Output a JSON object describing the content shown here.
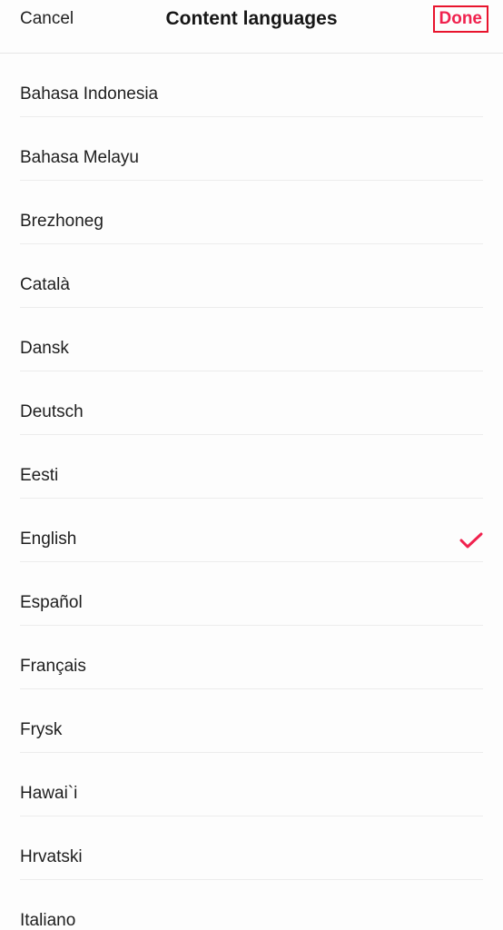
{
  "header": {
    "cancel_label": "Cancel",
    "title": "Content languages",
    "done_label": "Done"
  },
  "languages": [
    {
      "label": "Bahasa Indonesia",
      "selected": false
    },
    {
      "label": "Bahasa Melayu",
      "selected": false
    },
    {
      "label": "Brezhoneg",
      "selected": false
    },
    {
      "label": "Català",
      "selected": false
    },
    {
      "label": "Dansk",
      "selected": false
    },
    {
      "label": "Deutsch",
      "selected": false
    },
    {
      "label": "Eesti",
      "selected": false
    },
    {
      "label": "English",
      "selected": true
    },
    {
      "label": "Español",
      "selected": false
    },
    {
      "label": "Français",
      "selected": false
    },
    {
      "label": "Frysk",
      "selected": false
    },
    {
      "label": "Hawai`i",
      "selected": false
    },
    {
      "label": "Hrvatski",
      "selected": false
    },
    {
      "label": "Italiano",
      "selected": false
    }
  ],
  "colors": {
    "accent": "#f0224e",
    "done_border": "#e8142d",
    "divider": "#ececec",
    "background": "#fdfdfd"
  },
  "icons": {
    "selected_marker": "checkmark-icon"
  }
}
